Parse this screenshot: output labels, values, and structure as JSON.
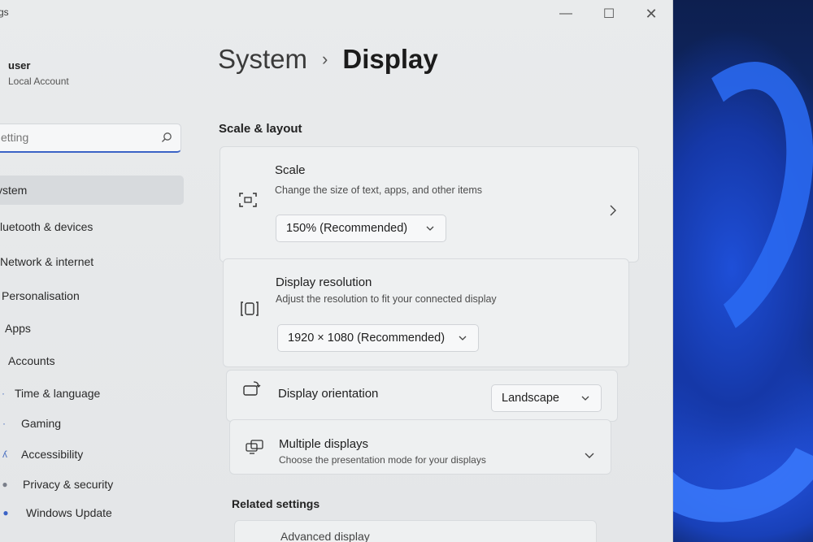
{
  "window": {
    "app_title": "gs",
    "controls": {
      "minimize": "—",
      "maximize": "☐",
      "close": "✕"
    }
  },
  "user": {
    "name": "user",
    "account_type": "Local Account"
  },
  "search": {
    "placeholder": "etting"
  },
  "sidebar": {
    "items": [
      {
        "label": "ystem",
        "active": true
      },
      {
        "label": "luetooth & devices"
      },
      {
        "label": "Network & internet"
      },
      {
        "label": "Personalisation"
      },
      {
        "label": "Apps"
      },
      {
        "label": "Accounts"
      },
      {
        "label": "Time & language"
      },
      {
        "label": "Gaming"
      },
      {
        "label": "Accessibility"
      },
      {
        "label": "Privacy & security"
      },
      {
        "label": "Windows Update"
      }
    ]
  },
  "breadcrumb": {
    "parent": "System",
    "separator": "›",
    "current": "Display"
  },
  "scale_layout": {
    "title": "Scale & layout",
    "scale": {
      "title": "Scale",
      "subtitle": "Change the size of text, apps, and other items",
      "value": "150% (Recommended)"
    },
    "resolution": {
      "title": "Display resolution",
      "subtitle": "Adjust the resolution to fit your connected display",
      "value": "1920 × 1080 (Recommended)"
    },
    "orientation": {
      "title": "Display orientation",
      "value": "Landscape"
    },
    "multiple": {
      "title": "Multiple displays",
      "subtitle": "Choose the presentation mode for your displays"
    }
  },
  "related": {
    "title": "Related settings",
    "advanced_display": "Advanced display"
  },
  "colors": {
    "accent": "#3b63c6",
    "wallpaper": "#2b6cf5"
  }
}
